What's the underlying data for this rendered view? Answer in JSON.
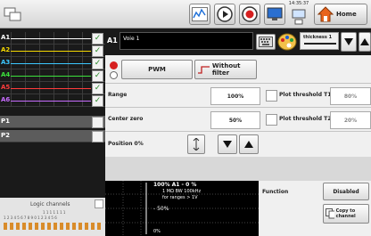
{
  "toolbar": {
    "clock": "14:35:37",
    "home_label": "Home",
    "icons": [
      "channel-switch-icon",
      "trend-screen-icon",
      "play-icon",
      "record-icon",
      "monitor-screen-icon",
      "network-config-icon",
      "home-icon"
    ]
  },
  "channels": [
    {
      "label": "A1",
      "color": "#ffffff"
    },
    {
      "label": "A2",
      "color": "#f5d800"
    },
    {
      "label": "A3",
      "color": "#3cc8ff"
    },
    {
      "label": "A4",
      "color": "#3ce23c"
    },
    {
      "label": "A5",
      "color": "#ff3c3c"
    },
    {
      "label": "A6",
      "color": "#c86cff"
    },
    {
      "label": "P1",
      "color": "#ffffff"
    },
    {
      "label": "P2",
      "color": "#ffffff"
    }
  ],
  "logic_label": "Logic channels",
  "logic_numbers_top": "1 1 1 1 1 1 1",
  "logic_numbers_bottom": "1 2 3 4 5 6 7 8 9 0 1 2 3 4 5 6",
  "channel": {
    "id": "A1",
    "name": "Voie 1",
    "thickness_label": "thickness 1"
  },
  "mode": {
    "pwm_label": "PWM",
    "filter_label": "Without filter"
  },
  "range": {
    "label": "Range",
    "value": "100%"
  },
  "center_zero": {
    "label": "Center zero",
    "value": "50%"
  },
  "position": {
    "label": "Position 0%"
  },
  "thresholds": [
    {
      "label": "Plot threshold T1",
      "value": "80%"
    },
    {
      "label": "Plot threshold T2",
      "value": "20%"
    }
  ],
  "scope": {
    "line1": "100%  A1   -   0 %",
    "line2": "1 MΩ BW 100kHz",
    "line3": "for ranges > 1V",
    "mid": "- 50%",
    "low": "0%"
  },
  "function": {
    "label": "Function",
    "value": "Disabled",
    "copy_label": "Copy to channel"
  }
}
